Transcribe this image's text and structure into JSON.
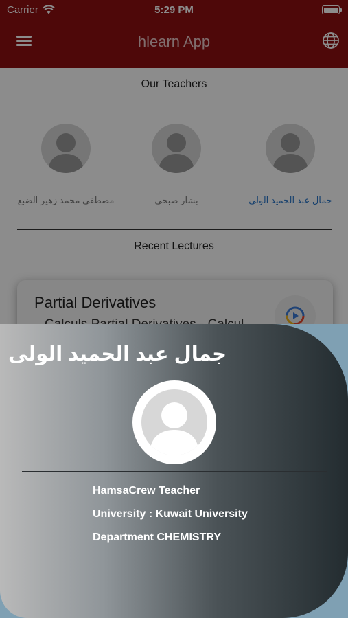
{
  "status_bar": {
    "carrier": "Carrier",
    "time": "5:29 PM"
  },
  "app_bar": {
    "title": "hlearn App",
    "menu_icon": "hamburger-menu-icon",
    "language_icon": "globe-icon"
  },
  "teachers_section": {
    "title": "Our Teachers",
    "teachers": [
      {
        "name": "جمال عبد الحميد الولى",
        "selected": true
      },
      {
        "name": "بشار صبحى",
        "selected": false
      },
      {
        "name": "مصطفى محمد زهير الضبع",
        "selected": false
      }
    ]
  },
  "lectures_section": {
    "title": "Recent Lectures",
    "lecture": {
      "title": "Partial Derivatives",
      "subtitle": "Calculs Partial Derivatives - Calcul",
      "play_icon": "play-icon"
    }
  },
  "teacher_sheet": {
    "name": "جمال عبد الحميد الولى",
    "role": "HamsaCrew Teacher",
    "university": "University : Kuwait University",
    "department": "Department CHEMISTRY"
  },
  "colors": {
    "app_bar": "#8f0f12",
    "selected_teacher": "#2a77c9",
    "sheet_bottom_bg": "#7fa0b3"
  }
}
